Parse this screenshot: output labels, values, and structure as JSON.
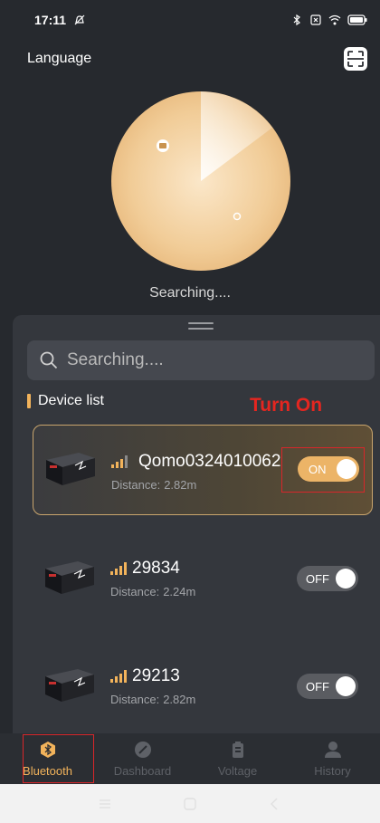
{
  "status_bar": {
    "time": "17:11"
  },
  "header": {
    "language_label": "Language"
  },
  "radar": {
    "caption": "Searching...."
  },
  "search": {
    "placeholder": "Searching...."
  },
  "device_list": {
    "title": "Device list",
    "annotation": "Turn On",
    "distance_label": "Distance:",
    "devices": [
      {
        "name": "Qomo0324010062",
        "distance": "2.82m",
        "toggle": "ON",
        "selected": true
      },
      {
        "name": "29834",
        "distance": "2.24m",
        "toggle": "OFF",
        "selected": false
      },
      {
        "name": "29213",
        "distance": "2.82m",
        "toggle": "OFF",
        "selected": false
      }
    ]
  },
  "bottom_nav": {
    "items": [
      {
        "label": "Bluetooth",
        "icon": "bluetooth-icon",
        "active": true
      },
      {
        "label": "Dashboard",
        "icon": "dashboard-icon",
        "active": false
      },
      {
        "label": "Voltage",
        "icon": "battery-icon",
        "active": false
      },
      {
        "label": "History",
        "icon": "user-icon",
        "active": false
      }
    ]
  },
  "colors": {
    "accent": "#f2b35b",
    "toggle_on": "#ecb467",
    "toggle_off": "#5a5c61",
    "annotation_red": "#e52620"
  }
}
